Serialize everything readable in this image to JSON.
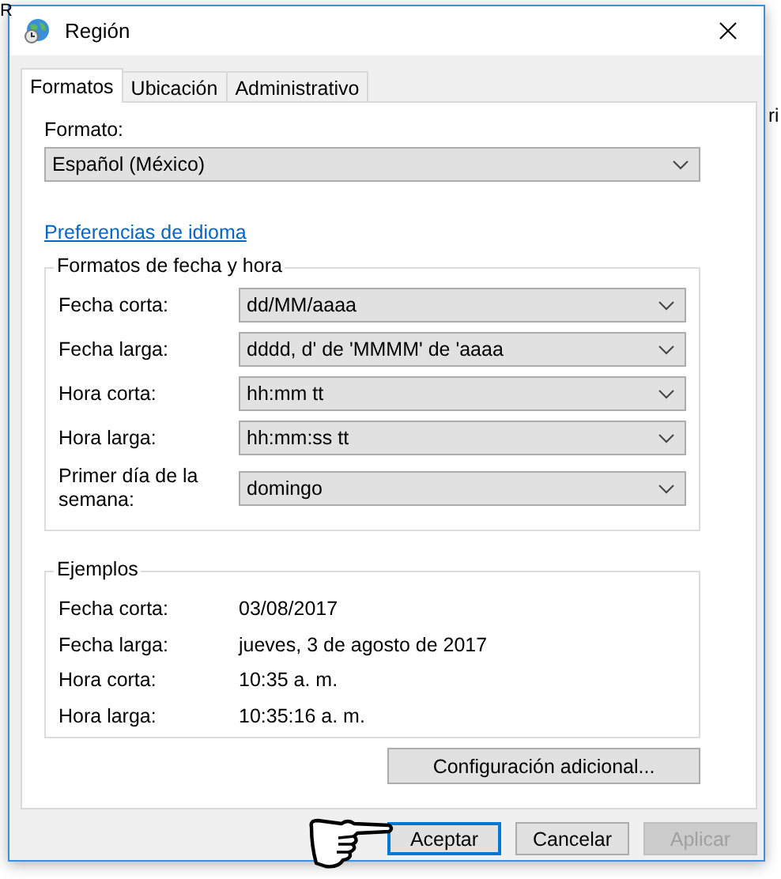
{
  "background_texts": [
    "R",
    "ri"
  ],
  "window": {
    "title": "Región"
  },
  "tabs": [
    {
      "label": "Formatos",
      "selected": true
    },
    {
      "label": "Ubicación",
      "selected": false
    },
    {
      "label": "Administrativo",
      "selected": false
    }
  ],
  "format": {
    "label": "Formato:",
    "value": "Español (México)"
  },
  "language_link": "Preferencias de idioma",
  "date_time_formats": {
    "title": "Formatos de fecha y hora",
    "fields": [
      {
        "label": "Fecha corta:",
        "value": "dd/MM/aaaa"
      },
      {
        "label": "Fecha larga:",
        "value": "dddd, d' de 'MMMM' de 'aaaa"
      },
      {
        "label": "Hora corta:",
        "value": "hh:mm tt"
      },
      {
        "label": "Hora larga:",
        "value": "hh:mm:ss tt"
      },
      {
        "label": "Primer día de la semana:",
        "value": "domingo"
      }
    ]
  },
  "examples": {
    "title": "Ejemplos",
    "rows": [
      {
        "label": "Fecha corta:",
        "value": "03/08/2017"
      },
      {
        "label": "Fecha larga:",
        "value": "jueves, 3 de agosto de 2017"
      },
      {
        "label": "Hora corta:",
        "value": "10:35 a. m."
      },
      {
        "label": "Hora larga:",
        "value": "10:35:16 a. m."
      }
    ]
  },
  "additional_button": "Configuración adicional...",
  "buttons": [
    {
      "label": "Aceptar",
      "focused": true,
      "disabled": false
    },
    {
      "label": "Cancelar",
      "focused": false,
      "disabled": false
    },
    {
      "label": "Aplicar",
      "focused": false,
      "disabled": true
    }
  ]
}
